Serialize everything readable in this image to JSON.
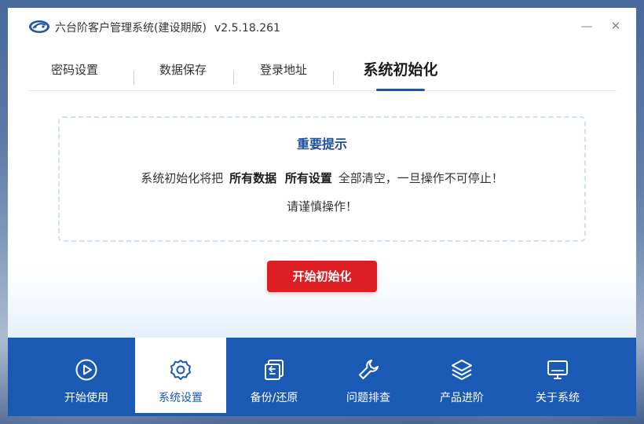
{
  "window": {
    "title": "六台阶客户管理系统(建设期版)",
    "version": "v2.5.18.261",
    "minimize_glyph": "—",
    "close_glyph": "✕"
  },
  "tabs": [
    {
      "label": "密码设置",
      "active": false
    },
    {
      "label": "数据保存",
      "active": false
    },
    {
      "label": "登录地址",
      "active": false
    },
    {
      "label": "系统初始化",
      "active": true
    }
  ],
  "notice": {
    "title": "重要提示",
    "line1_prefix": "系统初始化将把",
    "line1_bold1": "所有数据",
    "line1_bold2": "所有设置",
    "line1_suffix": "全部清空，一旦操作不可停止！",
    "line2": "请谨慎操作！"
  },
  "init_button": {
    "label": "开始初始化"
  },
  "bottom_nav": [
    {
      "label": "开始使用",
      "icon": "play-icon",
      "active": false
    },
    {
      "label": "系统设置",
      "icon": "gear-icon",
      "active": true
    },
    {
      "label": "备份/还原",
      "icon": "backup-restore-icon",
      "active": false
    },
    {
      "label": "问题排查",
      "icon": "wrench-icon",
      "active": false
    },
    {
      "label": "产品进阶",
      "icon": "layers-icon",
      "active": false
    },
    {
      "label": "关于系统",
      "icon": "monitor-icon",
      "active": false
    }
  ],
  "colors": {
    "accent": "#1a59b4",
    "danger": "#dd1f24",
    "notice_title": "#1e4f9a"
  }
}
